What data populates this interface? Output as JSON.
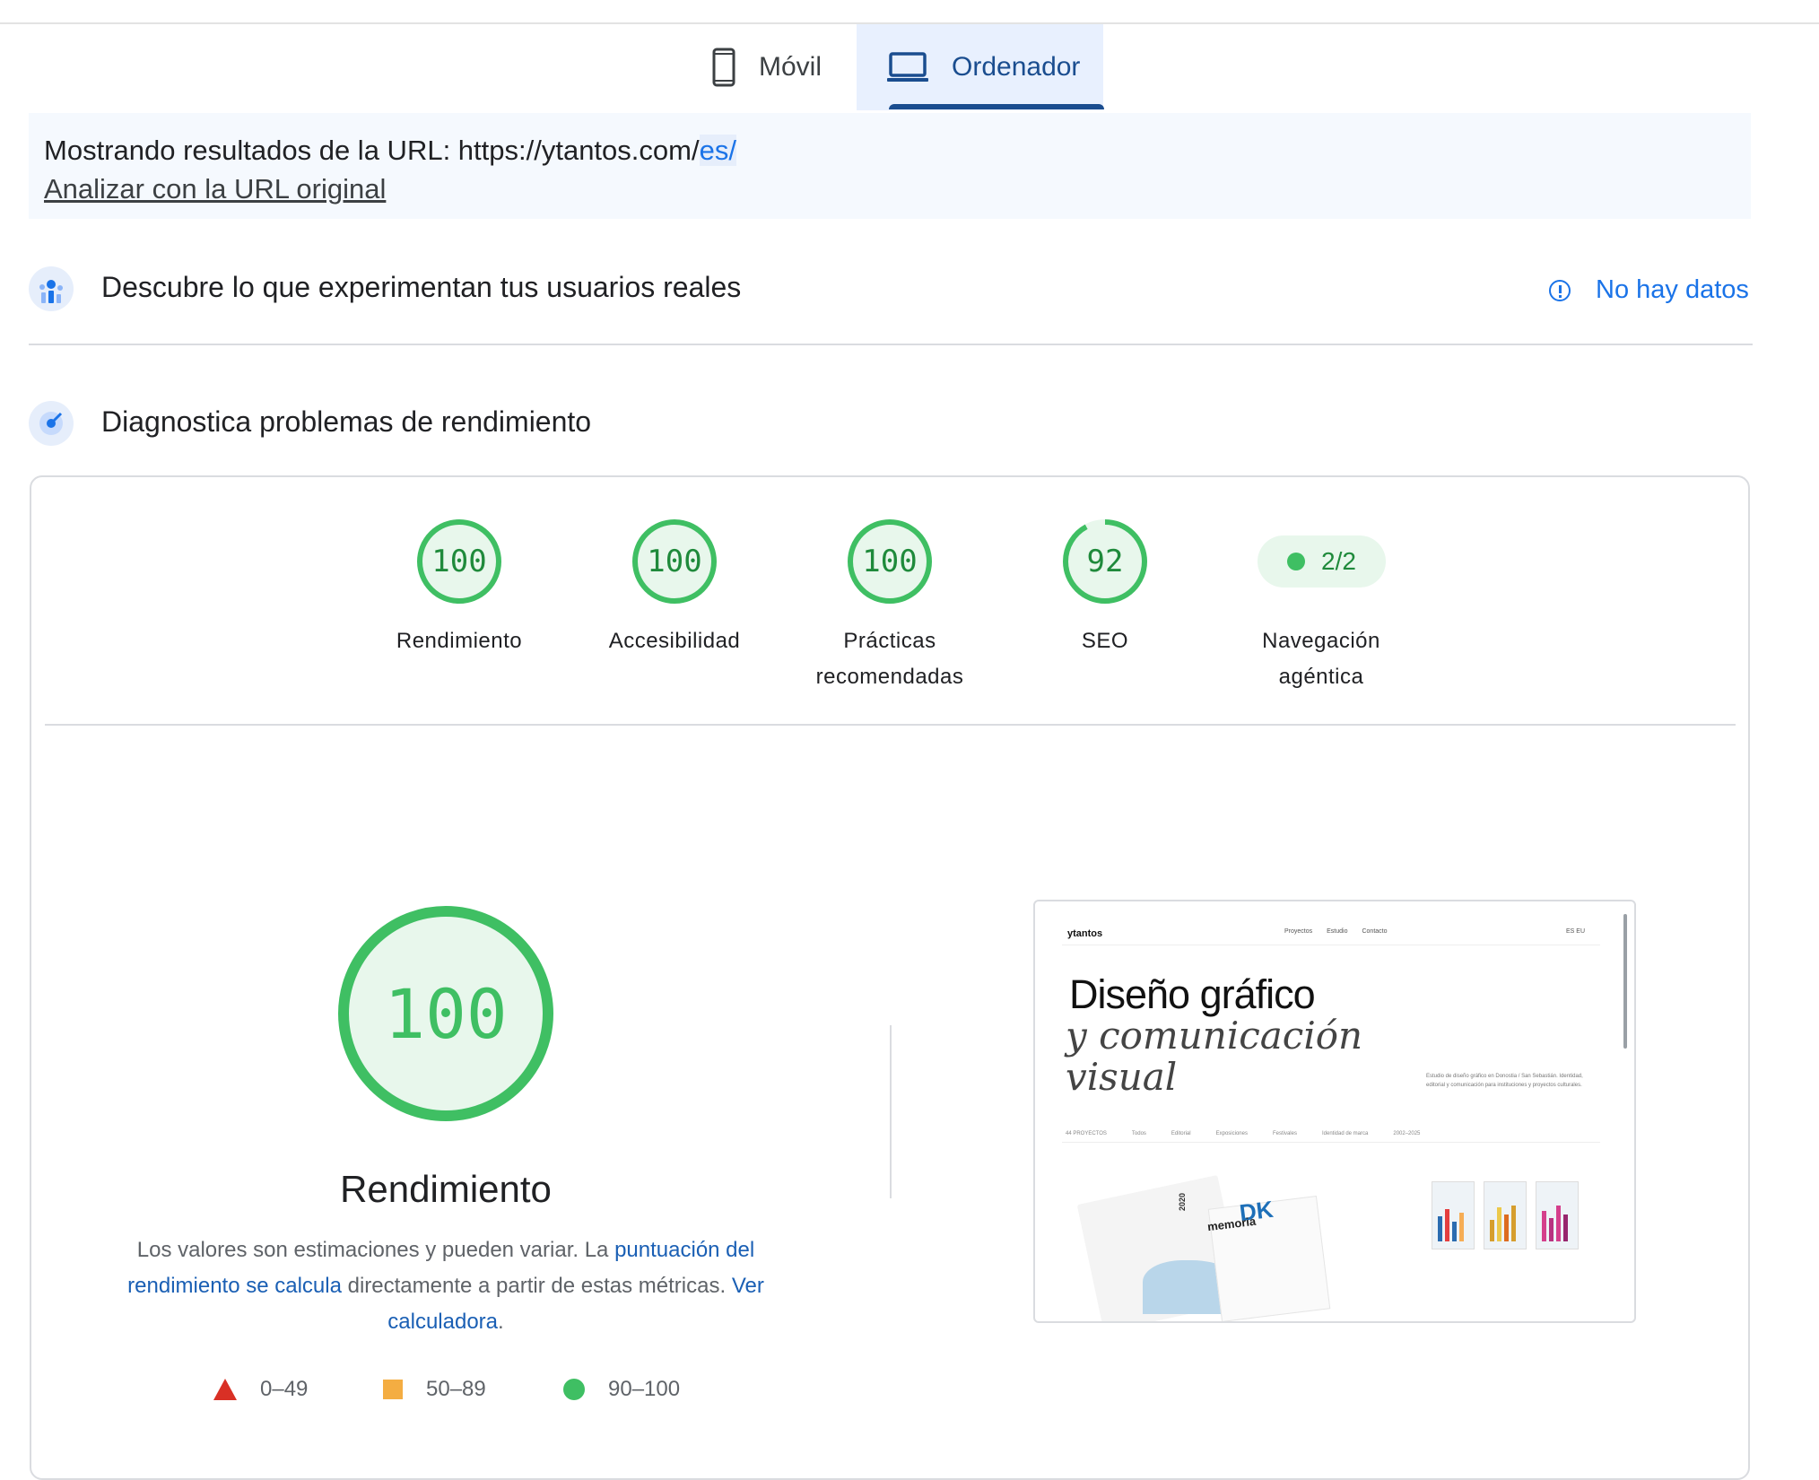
{
  "tabs": {
    "mobile": {
      "label": "Móvil",
      "icon": "phone-icon"
    },
    "desktop": {
      "label": "Ordenador",
      "icon": "laptop-icon",
      "selected": true
    }
  },
  "url_banner": {
    "prefix": "Mostrando resultados de la URL: https://ytantos.com/",
    "highlight": "es/",
    "link": "Analizar con la URL original"
  },
  "field_data": {
    "title": "Descubre lo que experimentan tus usuarios reales",
    "status": "No hay datos",
    "icon": "users-chart-icon",
    "status_icon": "info-icon"
  },
  "lab_data": {
    "title": "Diagnostica problemas de rendimiento",
    "icon": "speed-dial-icon"
  },
  "scores": [
    {
      "value": "100",
      "label": "Rendimiento"
    },
    {
      "value": "100",
      "label": "Accesibilidad"
    },
    {
      "value": "100",
      "label": "Prácticas recomendadas"
    },
    {
      "value": "92",
      "label": "SEO",
      "fraction": 0.92
    }
  ],
  "agentic": {
    "value": "2/2",
    "label": "Navegación agéntica"
  },
  "performance": {
    "score": "100",
    "title": "Rendimiento",
    "desc_1": "Los valores son estimaciones y pueden variar. La ",
    "desc_link_1": "puntuación del rendimiento se calcula",
    "desc_2": " directamente a partir de estas métricas. ",
    "desc_link_2": "Ver calculadora",
    "desc_3": "."
  },
  "legend": [
    {
      "range": "0–49",
      "color": "#d93025",
      "shape": "triangle"
    },
    {
      "range": "50–89",
      "color": "#f4ad42",
      "shape": "square"
    },
    {
      "range": "90–100",
      "color": "#3fbf63",
      "shape": "circle"
    }
  ],
  "screenshot": {
    "logo": "ytantos",
    "nav": [
      "Proyectos",
      "Estudio",
      "Contacto"
    ],
    "lang": "ES   EU",
    "headline": "Diseño gráfico",
    "subheadline_1": "y comunicación",
    "subheadline_2": "visual",
    "blurb": "Estudio de diseño gráfico en Donostia / San Sebastián. Identidad, editorial y comunicación para instituciones y proyectos culturales.",
    "filters": [
      "44 PROYECTOS",
      "Todos",
      "Editorial",
      "Exposiciones",
      "Festivales",
      "Identidad de marca",
      "2002–2025"
    ],
    "mag_year": "2020",
    "mag_brand": "DK",
    "mag_title": "memoria"
  },
  "colors": {
    "pass": "#3fbf63",
    "average": "#f4ad42",
    "fail": "#d93025",
    "accent": "#1a73e8",
    "tab_selected_bg": "#e8f0fe"
  }
}
